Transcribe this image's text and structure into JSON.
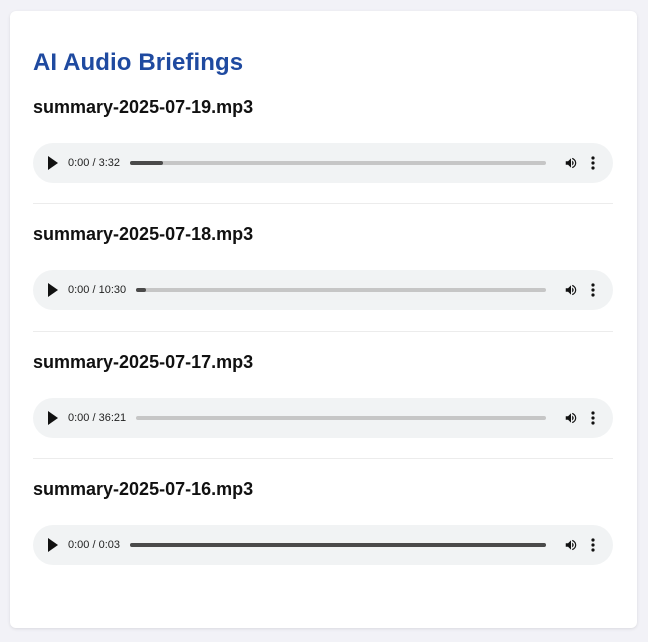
{
  "page": {
    "title": "AI Audio Briefings"
  },
  "items": [
    {
      "file_name": "summary-2025-07-19.mp3",
      "time": "0:00 / 3:32",
      "buffered": 0.08
    },
    {
      "file_name": "summary-2025-07-18.mp3",
      "time": "0:00 / 10:30",
      "buffered": 0.025
    },
    {
      "file_name": "summary-2025-07-17.mp3",
      "time": "0:00 / 36:21",
      "buffered": 0
    },
    {
      "file_name": "summary-2025-07-16.mp3",
      "time": "0:00 / 0:03",
      "buffered": 1
    }
  ],
  "icons": {
    "play": "play-icon",
    "volume": "volume-icon",
    "menu": "more-vertical-icon"
  },
  "colors": {
    "title": "#1f4aa0",
    "player_bg": "#f1f3f4",
    "track": "#c6c6c6",
    "track_fill": "#4a4a4a"
  }
}
